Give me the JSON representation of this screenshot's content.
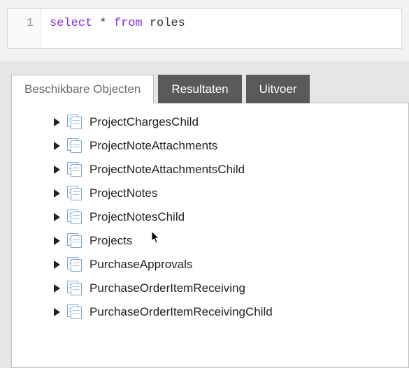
{
  "editor": {
    "line_number": "1",
    "tokens": {
      "select": "select",
      "star": " * ",
      "from": "from",
      "roles": " roles"
    }
  },
  "tabs": {
    "available": "Beschikbare Objecten",
    "results": "Resultaten",
    "output": "Uitvoer"
  },
  "objects": [
    "ProjectChargesChild",
    "ProjectNoteAttachments",
    "ProjectNoteAttachmentsChild",
    "ProjectNotes",
    "ProjectNotesChild",
    "Projects",
    "PurchaseApprovals",
    "PurchaseOrderItemReceiving",
    "PurchaseOrderItemReceivingChild"
  ]
}
